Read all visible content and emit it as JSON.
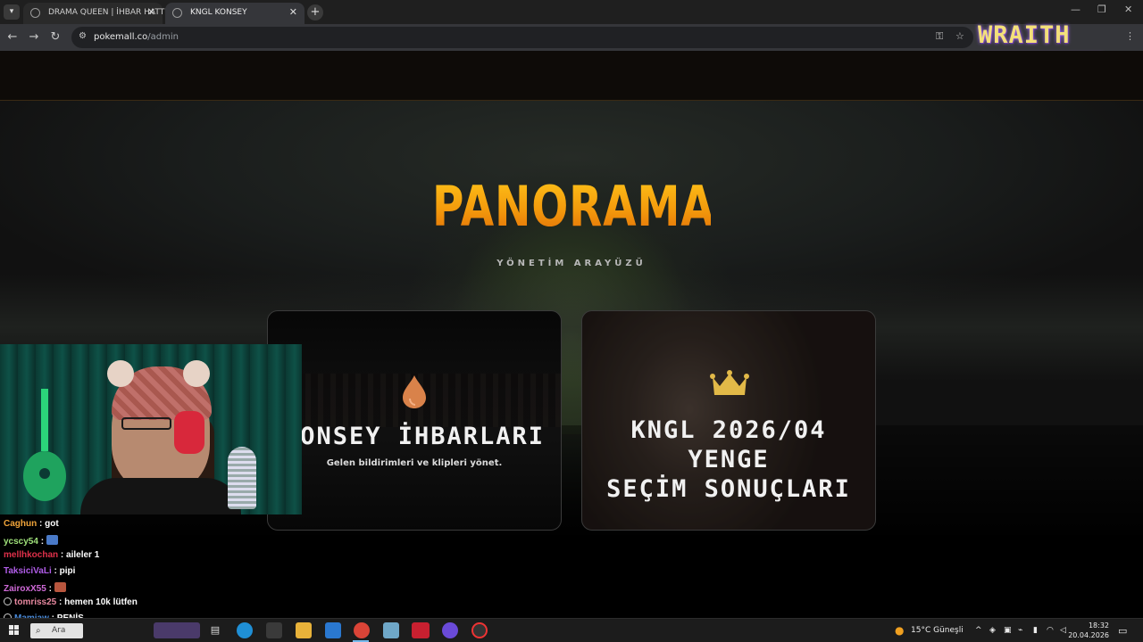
{
  "browser": {
    "tabs": [
      {
        "title": "DRAMA QUEEN | İHBAR HATTI",
        "active": false
      },
      {
        "title": "KNGL KONSEY",
        "active": true
      }
    ],
    "url_host": "pokemall.co",
    "url_path": "/admin"
  },
  "overlay": {
    "wraith_text": "WRAITH"
  },
  "page": {
    "title": "PANORAMA",
    "subtitle": "YÖNETİM ARAYÜZÜ",
    "cards": [
      {
        "title": "KONSEY İHBARLARI",
        "description": "Gelen bildirimleri ve klipleri yönet.",
        "icon": "drop-icon"
      },
      {
        "title_line1": "KNGL 2026/04 YENGE",
        "title_line2": "SEÇİM SONUÇLARI",
        "icon": "crown-icon"
      }
    ]
  },
  "chat": {
    "messages": [
      {
        "user": "Caghun",
        "text": " : got",
        "color": "#f0a43a"
      },
      {
        "user": "ycscy54",
        "text": " : ",
        "color": "#9fe07a"
      },
      {
        "user": "mellhkochan",
        "text": " : aileler 1",
        "color": "#e0304a"
      },
      {
        "user": "TaksiciVaLi",
        "text": " : pipi",
        "color": "#b05ce8"
      },
      {
        "user": "ZairoxX55",
        "text": " : ",
        "color": "#d06ad8"
      },
      {
        "user": "tomriss25",
        "text": " : hemen 10k lütfen",
        "color": "#e889a0"
      },
      {
        "user": "Mamiaw",
        "text": " : PENİS",
        "color": "#4a8ad8"
      }
    ]
  },
  "taskbar": {
    "search_placeholder": "Ara",
    "weather": "15°C  Güneşli",
    "time": "18:32",
    "date": "20.04.2026"
  },
  "colors": {
    "title_gradient_top": "#ffc61a",
    "title_gradient_bottom": "#e06a08",
    "accent_purple": "#8a4be0"
  }
}
